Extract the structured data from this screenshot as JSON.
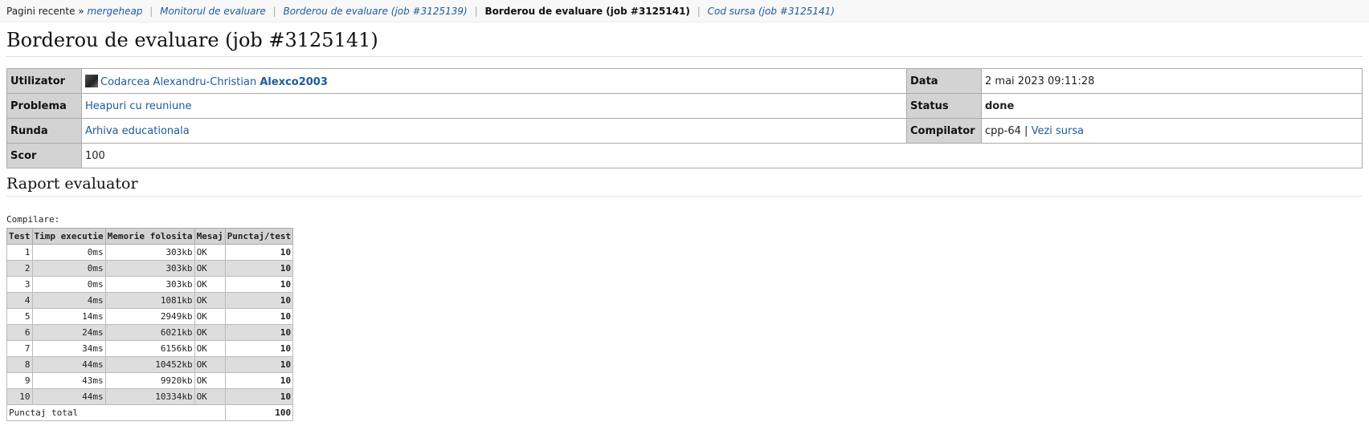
{
  "breadcrumbs": {
    "prefix": "Pagini recente »",
    "items": [
      {
        "label": "mergeheap",
        "current": false
      },
      {
        "label": "Monitorul de evaluare",
        "current": false
      },
      {
        "label": "Borderou de evaluare (job #3125139)",
        "current": false
      },
      {
        "label": "Borderou de evaluare (job #3125141)",
        "current": true
      },
      {
        "label": "Cod sursa (job #3125141)",
        "current": false
      }
    ]
  },
  "page_title": "Borderou de evaluare (job #3125141)",
  "info": {
    "user_label": "Utilizator",
    "user_name": "Codarcea Alexandru-Christian",
    "user_nick": "Alexco2003",
    "date_label": "Data",
    "date_value": "2 mai 2023 09:11:28",
    "problem_label": "Problema",
    "problem_value": "Heapuri cu reuniune",
    "status_label": "Status",
    "status_value": "done",
    "round_label": "Runda",
    "round_value": "Arhiva educationala",
    "compiler_label": "Compilator",
    "compiler_value": "cpp-64",
    "compiler_sep": "|",
    "view_source": "Vezi sursa",
    "score_label": "Scor",
    "score_value": "100"
  },
  "report_title": "Raport evaluator",
  "compile_label": "Compilare:",
  "tests_table": {
    "headers": [
      "Test",
      "Timp executie",
      "Memorie folosita",
      "Mesaj",
      "Punctaj/test"
    ],
    "rows": [
      [
        "1",
        "0ms",
        "303kb",
        "OK",
        "10"
      ],
      [
        "2",
        "0ms",
        "303kb",
        "OK",
        "10"
      ],
      [
        "3",
        "0ms",
        "303kb",
        "OK",
        "10"
      ],
      [
        "4",
        "4ms",
        "1081kb",
        "OK",
        "10"
      ],
      [
        "5",
        "14ms",
        "2949kb",
        "OK",
        "10"
      ],
      [
        "6",
        "24ms",
        "6021kb",
        "OK",
        "10"
      ],
      [
        "7",
        "34ms",
        "6156kb",
        "OK",
        "10"
      ],
      [
        "8",
        "44ms",
        "10452kb",
        "OK",
        "10"
      ],
      [
        "9",
        "43ms",
        "9920kb",
        "OK",
        "10"
      ],
      [
        "10",
        "44ms",
        "10334kb",
        "OK",
        "10"
      ]
    ],
    "total_label": "Punctaj total",
    "total_value": "100"
  }
}
